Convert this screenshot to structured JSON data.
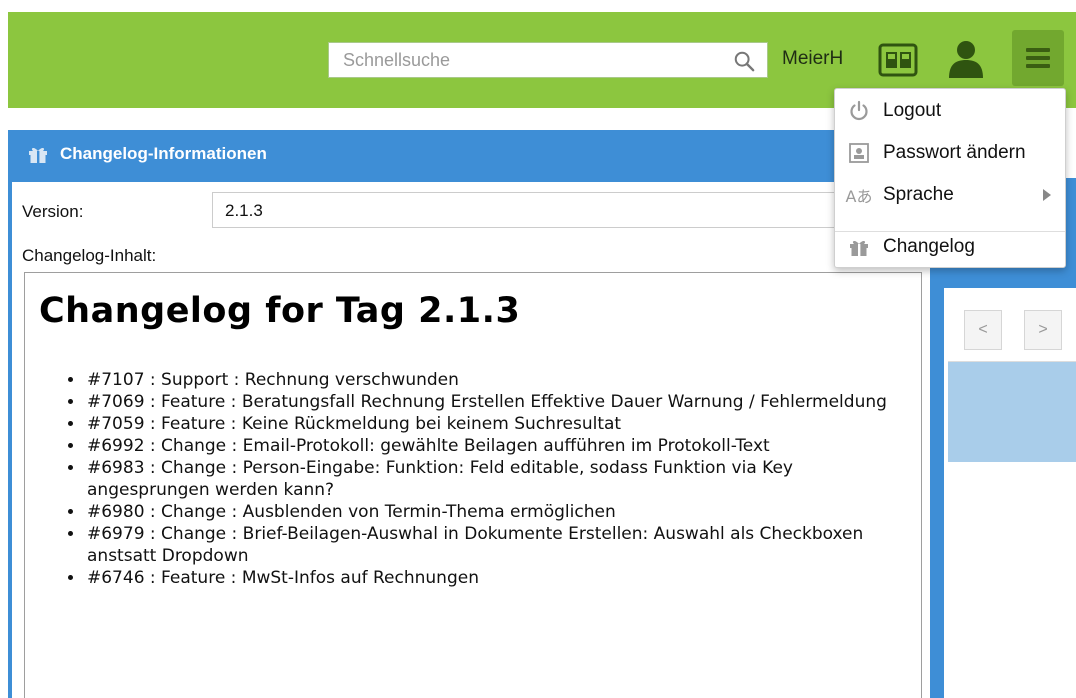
{
  "header": {
    "search_placeholder": "Schnellsuche",
    "username": "MeierH",
    "brand_color": "#8cc63f",
    "icons": [
      "search-icon",
      "id-card-icon",
      "user-icon",
      "hamburger-menu-icon"
    ]
  },
  "user_menu": {
    "items": [
      {
        "label": "Logout",
        "icon": "power-icon"
      },
      {
        "label": "Passwort ändern",
        "icon": "password-card-icon"
      },
      {
        "label": "Sprache",
        "icon": "language-icon",
        "has_submenu": true
      },
      {
        "label": "Changelog",
        "icon": "gift-icon"
      }
    ]
  },
  "panel": {
    "title": "Changelog-Informationen",
    "title_icon": "gift-icon",
    "accent_color": "#3e8ed6",
    "version_label": "Version:",
    "version_value": "2.1.3",
    "content_label": "Changelog-Inhalt:",
    "changelog": {
      "heading": "Changelog for Tag 2.1.3",
      "entries": [
        "#7107 : Support : Rechnung verschwunden",
        "#7069 : Feature : Beratungsfall Rechnung Erstellen Effektive Dauer Warnung / Fehlermeldung",
        "#7059 : Feature : Keine Rückmeldung bei keinem Suchresultat",
        "#6992 : Change : Email-Protokoll: gewählte Beilagen aufführen im Protokoll-Text",
        "#6983 : Change : Person-Eingabe: Funktion: Feld editable, sodass Funktion via Key angesprungen werden kann?",
        "#6980 : Change : Ausblenden von Termin-Thema ermöglichen",
        "#6979 : Change : Brief-Beilagen-Auswhal in Dokumente Erstellen: Auswahl als Checkboxen anstsatt Dropdown",
        "#6746 : Feature : MwSt-Infos auf Rechnungen"
      ]
    }
  },
  "side_nav": {
    "prev_label": "<",
    "next_label": ">"
  }
}
